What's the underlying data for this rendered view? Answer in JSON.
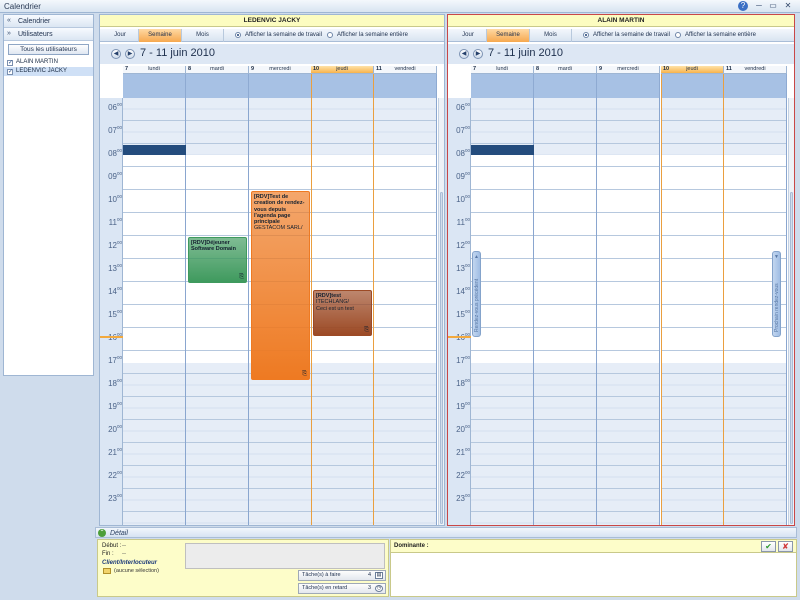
{
  "window": {
    "title": "Calendrier",
    "controls": [
      "?",
      "─",
      "▭",
      "✕"
    ]
  },
  "left_panel": {
    "sections": [
      {
        "label": "Calendrier",
        "chevron": "«"
      },
      {
        "label": "Utilisateurs",
        "chevron": "»"
      }
    ],
    "all_users_button": "Tous les utilisateurs",
    "users": [
      {
        "name": "ALAIN MARTIN",
        "checked": true,
        "selected": false
      },
      {
        "name": "LEDENVIC JACKY",
        "checked": true,
        "selected": true
      }
    ]
  },
  "calendars": [
    {
      "user": "LEDENVIC JACKY",
      "views": [
        "Jour",
        "Semaine",
        "Mois"
      ],
      "active_view": "Semaine",
      "options": [
        "Afficher la semaine de travail",
        "Afficher la semaine entière"
      ],
      "selected_option": 0,
      "range": "7 - 11 juin 2010",
      "days": [
        {
          "num": "7",
          "name": "lundi",
          "today": false
        },
        {
          "num": "8",
          "name": "mardi",
          "today": false
        },
        {
          "num": "9",
          "name": "mercredi",
          "today": false
        },
        {
          "num": "10",
          "name": "jeudi",
          "today": true
        },
        {
          "num": "11",
          "name": "vendredi",
          "today": false
        }
      ],
      "appointments": [
        {
          "day": 1,
          "start": 12.0,
          "end": 14.0,
          "color": "#3f9a5e",
          "title": "[RDV]Déjeuner Software Domain",
          "lines": []
        },
        {
          "day": 2,
          "start": 10.0,
          "end": 18.2,
          "color": "#ee7a22",
          "title": "[RDV]Test de creation de rendez-vous depuis l'agenda page principale",
          "lines": [
            "GESTACOM SARL/"
          ]
        },
        {
          "day": 3,
          "start": 14.3,
          "end": 16.3,
          "color": "#9c4a25",
          "title": "[RDV]test",
          "lines": [
            "ITECHLANG/",
            "Ceci est un test"
          ]
        }
      ],
      "all_day_events": [
        {
          "day": 0,
          "hour": 8.0
        }
      ]
    },
    {
      "user": "ALAIN MARTIN",
      "views": [
        "Jour",
        "Semaine",
        "Mois"
      ],
      "active_view": "Semaine",
      "options": [
        "Afficher la semaine de travail",
        "Afficher la semaine entière"
      ],
      "selected_option": 0,
      "range": "7 - 11 juin 2010",
      "days": [
        {
          "num": "7",
          "name": "lundi",
          "today": false
        },
        {
          "num": "8",
          "name": "mardi",
          "today": false
        },
        {
          "num": "9",
          "name": "mercredi",
          "today": false
        },
        {
          "num": "10",
          "name": "jeudi",
          "today": true
        },
        {
          "num": "11",
          "name": "vendredi",
          "today": false
        }
      ],
      "appointments": [],
      "all_day_events": [
        {
          "day": 0,
          "hour": 8.0
        }
      ],
      "side_tabs": [
        "Rendez-vous précédent",
        "Prochain rendez-vous"
      ]
    }
  ],
  "hours": [
    "06",
    "07",
    "08",
    "09",
    "10",
    "11",
    "12",
    "13",
    "14",
    "15",
    "16",
    "17",
    "18",
    "19",
    "20",
    "21",
    "22",
    "23"
  ],
  "hour_suffix": "00",
  "detail": {
    "title": "Détail",
    "start_label": "Début :",
    "start_value": "--",
    "end_label": "Fin :",
    "end_value": "--",
    "client_label": "Client/Interlocuteur",
    "no_selection": "(aucune sélection)",
    "tasks_todo_label": "Tâche(s) à faire",
    "tasks_todo_count": "4",
    "tasks_late_label": "Tâche(s) en retard",
    "tasks_late_count": "3",
    "dominante_label": "Dominante :"
  }
}
